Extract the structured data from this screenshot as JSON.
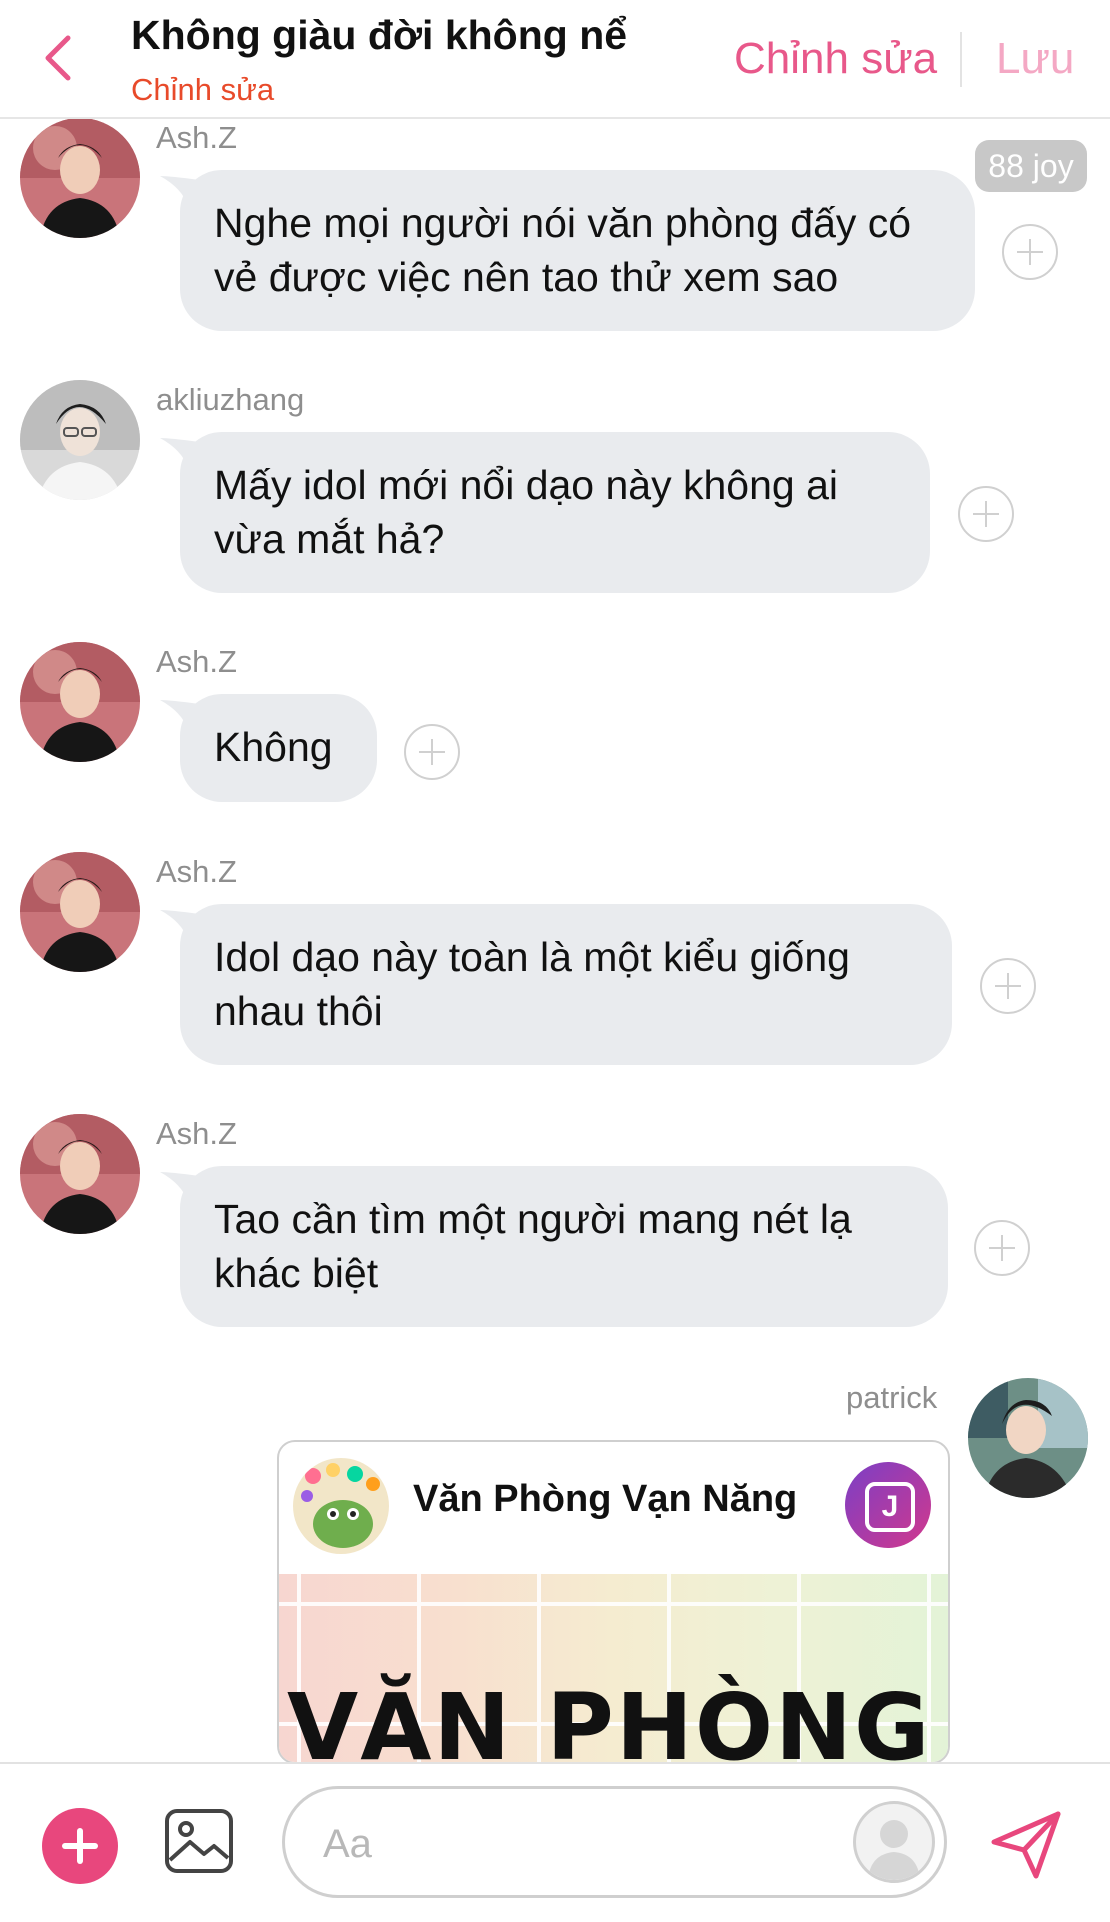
{
  "header": {
    "back_icon": "chevron-left-icon",
    "title": "Không giàu đời không nể",
    "subtitle": "Chỉnh sửa",
    "edit_label": "Chỉnh sửa",
    "save_label": "Lưu",
    "accent_color": "#e8588a"
  },
  "joy_badge": "88 joy",
  "messages": [
    {
      "sender": "Ash.Z",
      "text": "Nghe mọi người nói văn phòng đấy có vẻ được việc nên tao thử xem sao",
      "avatar": "ash-z-avatar"
    },
    {
      "sender": "akliuzhang",
      "text": "Mấy idol mới nổi dạo này không ai vừa mắt hả?",
      "avatar": "akliuzhang-avatar"
    },
    {
      "sender": "Ash.Z",
      "text": "Không",
      "avatar": "ash-z-avatar"
    },
    {
      "sender": "Ash.Z",
      "text": "Idol dạo này toàn là một kiểu giống nhau thôi",
      "avatar": "ash-z-avatar"
    },
    {
      "sender": "Ash.Z",
      "text": "Tao cần tìm một người mang nét lạ khác biệt",
      "avatar": "ash-z-avatar"
    },
    {
      "sender": "patrick",
      "avatar": "patrick-avatar"
    }
  ],
  "shared_card": {
    "title": "Văn Phòng Vạn Năng",
    "badge_letter": "J",
    "cover_text": "VĂN PHÒNG"
  },
  "composer": {
    "placeholder": "Aa",
    "value": "",
    "add_icon": "plus-icon",
    "image_icon": "image-icon",
    "profile_icon": "user-silhouette-icon",
    "send_icon": "send-icon",
    "send_color": "#e8477d"
  }
}
